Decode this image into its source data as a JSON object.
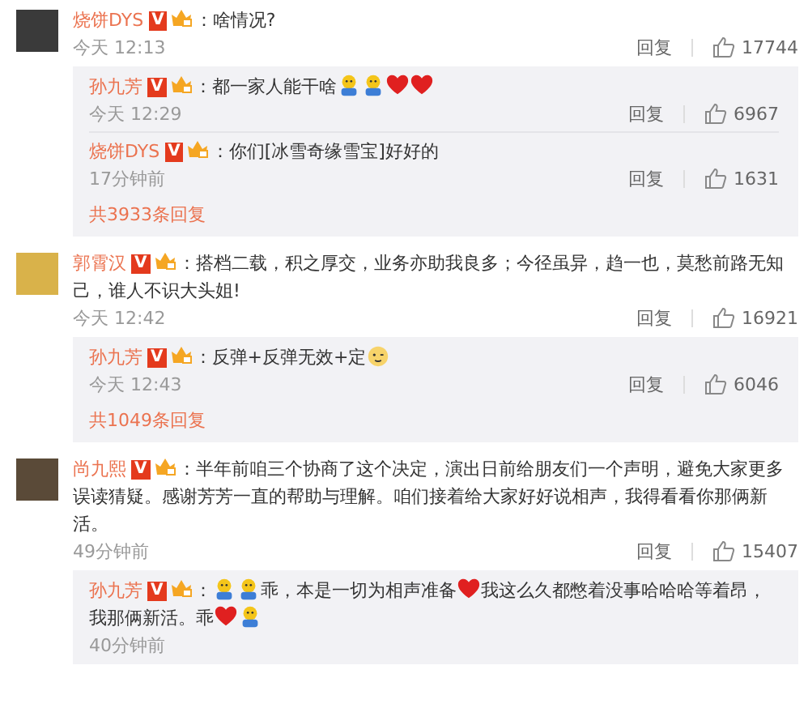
{
  "comments": [
    {
      "author": "烧饼DYS",
      "badge": "V",
      "body": [
        {
          "kind": "text",
          "text": "：啥情况?"
        }
      ],
      "time": "今天 12:13",
      "reply_label": "回复",
      "like_count": "17744",
      "replies": [
        {
          "author": "孙九芳",
          "badge": "V",
          "body": [
            {
              "kind": "text",
              "text": "：都一家人能干啥"
            },
            {
              "kind": "doll"
            },
            {
              "kind": "doll"
            },
            {
              "kind": "heart"
            },
            {
              "kind": "heart"
            }
          ],
          "time": "今天 12:29",
          "reply_label": "回复",
          "like_count": "6967"
        },
        {
          "author": "烧饼DYS",
          "badge": "V",
          "body": [
            {
              "kind": "text",
              "text": "：你们[冰雪奇缘雪宝]好好的"
            }
          ],
          "time": "17分钟前",
          "reply_label": "回复",
          "like_count": "1631"
        }
      ],
      "more_replies": "共3933条回复"
    },
    {
      "author": "郭霄汉",
      "badge": "V",
      "body": [
        {
          "kind": "text",
          "text": "：搭档二载，积之厚交，业务亦助我良多；今径虽异，趋一也，莫愁前路无知己，谁人不识大头姐!"
        }
      ],
      "time": "今天 12:42",
      "reply_label": "回复",
      "like_count": "16921",
      "replies": [
        {
          "author": "孙九芳",
          "badge": "V",
          "body": [
            {
              "kind": "text",
              "text": "：反弹+反弹无效+定"
            },
            {
              "kind": "face"
            }
          ],
          "time": "今天 12:43",
          "reply_label": "回复",
          "like_count": "6046"
        }
      ],
      "more_replies": "共1049条回复"
    },
    {
      "author": "尚九熙",
      "badge": "V",
      "body": [
        {
          "kind": "text",
          "text": "：半年前咱三个协商了这个决定，演出日前给朋友们一个声明，避免大家更多误读猜疑。感谢芳芳一直的帮助与理解。咱们接着给大家好好说相声，我得看看你那俩新活。"
        }
      ],
      "time": "49分钟前",
      "reply_label": "回复",
      "like_count": "15407",
      "replies": [
        {
          "author": "孙九芳",
          "badge": "V",
          "body": [
            {
              "kind": "text",
              "text": "："
            },
            {
              "kind": "doll"
            },
            {
              "kind": "doll"
            },
            {
              "kind": "text",
              "text": "乖，本是一切为相声准备"
            },
            {
              "kind": "heart"
            },
            {
              "kind": "text",
              "text": "我这么久都憋着没事哈哈哈等着昂，我那俩新活。乖"
            },
            {
              "kind": "heart"
            },
            {
              "kind": "doll"
            }
          ],
          "time": "40分钟前"
        }
      ]
    }
  ]
}
